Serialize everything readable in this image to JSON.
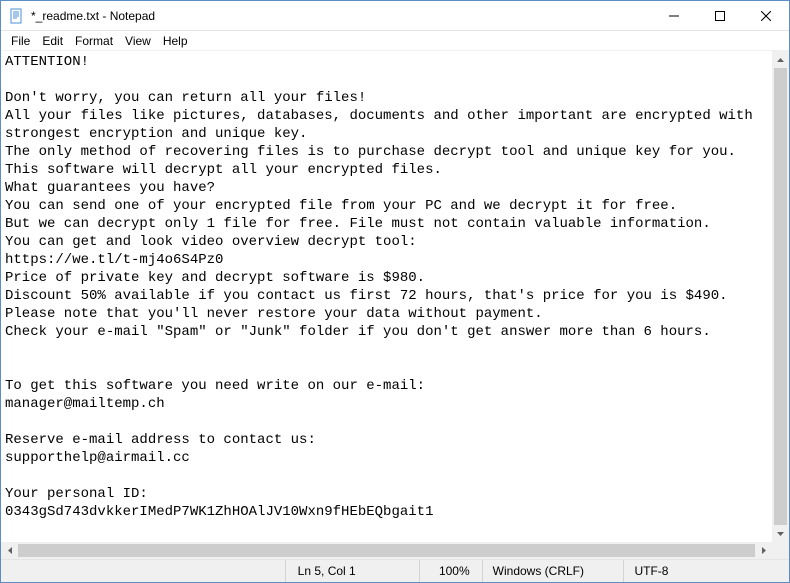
{
  "window": {
    "title": "*_readme.txt - Notepad"
  },
  "menu": {
    "file": "File",
    "edit": "Edit",
    "format": "Format",
    "view": "View",
    "help": "Help"
  },
  "content": "ATTENTION!\n\nDon't worry, you can return all your files!\nAll your files like pictures, databases, documents and other important are encrypted with strongest encryption and unique key.\nThe only method of recovering files is to purchase decrypt tool and unique key for you.\nThis software will decrypt all your encrypted files.\nWhat guarantees you have?\nYou can send one of your encrypted file from your PC and we decrypt it for free.\nBut we can decrypt only 1 file for free. File must not contain valuable information.\nYou can get and look video overview decrypt tool:\nhttps://we.tl/t-mj4o6S4Pz0\nPrice of private key and decrypt software is $980.\nDiscount 50% available if you contact us first 72 hours, that's price for you is $490.\nPlease note that you'll never restore your data without payment.\nCheck your e-mail \"Spam\" or \"Junk\" folder if you don't get answer more than 6 hours.\n\n\nTo get this software you need write on our e-mail:\nmanager@mailtemp.ch\n\nReserve e-mail address to contact us:\nsupporthelp@airmail.cc\n\nYour personal ID:\n0343gSd743dvkkerIMedP7WK1ZhHOAlJV10Wxn9fHEbEQbgait1",
  "status": {
    "position": "Ln 5, Col 1",
    "zoom": "100%",
    "eol": "Windows (CRLF)",
    "encoding": "UTF-8"
  }
}
